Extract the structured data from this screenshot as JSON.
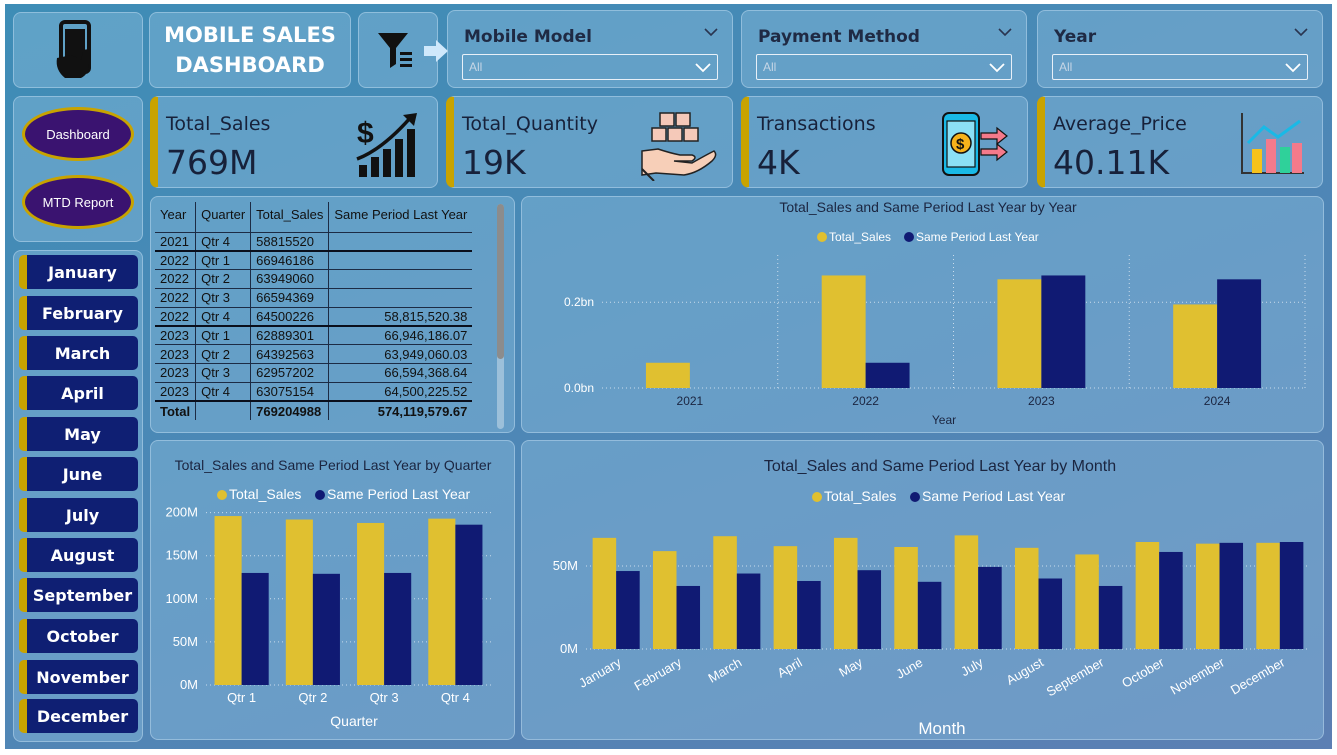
{
  "header": {
    "title": "MOBILE SALES\nDASHBOARD",
    "slicers": [
      {
        "label": "Mobile Model",
        "value": "All"
      },
      {
        "label": "Payment Method",
        "value": "All"
      },
      {
        "label": "Year",
        "value": "All"
      }
    ]
  },
  "nav": {
    "dashboard": "Dashboard",
    "mtd": "MTD Report"
  },
  "months": [
    "January",
    "February",
    "March",
    "April",
    "May",
    "June",
    "July",
    "August",
    "September",
    "October",
    "November",
    "December"
  ],
  "kpis": [
    {
      "label": "Total_Sales",
      "value": "769M",
      "icon": "dollar-growth-icon"
    },
    {
      "label": "Total_Quantity",
      "value": "19K",
      "icon": "boxes-hand-icon"
    },
    {
      "label": "Transactions",
      "value": "4K",
      "icon": "phone-payment-icon"
    },
    {
      "label": "Average_Price",
      "value": "40.11K",
      "icon": "bar-chart-icon"
    }
  ],
  "table": {
    "headers": [
      "Year",
      "Quarter",
      "Total_Sales",
      "Same Period Last Year"
    ],
    "rows": [
      [
        "2021",
        "Qtr 4",
        "58815520",
        ""
      ],
      [
        "2022",
        "Qtr 1",
        "66946186",
        ""
      ],
      [
        "2022",
        "Qtr 2",
        "63949060",
        ""
      ],
      [
        "2022",
        "Qtr 3",
        "66594369",
        ""
      ],
      [
        "2022",
        "Qtr 4",
        "64500226",
        "58,815,520.38"
      ],
      [
        "2023",
        "Qtr 1",
        "62889301",
        "66,946,186.07"
      ],
      [
        "2023",
        "Qtr 2",
        "64392563",
        "63,949,060.03"
      ],
      [
        "2023",
        "Qtr 3",
        "62957202",
        "66,594,368.64"
      ],
      [
        "2023",
        "Qtr 4",
        "63075154",
        "64,500,225.52"
      ]
    ],
    "total": [
      "Total",
      "",
      "769204988",
      "574,119,579.67"
    ]
  },
  "colors": {
    "total_sales": "#e0c030",
    "same_period": "#101a73",
    "accent": "#c8a300"
  },
  "chart_data": [
    {
      "type": "bar",
      "title": "Total_Sales and Same Period Last Year by Year",
      "xlabel": "Year",
      "ylabel": "",
      "categories": [
        "2021",
        "2022",
        "2023",
        "2024"
      ],
      "series": [
        {
          "name": "Total_Sales",
          "values": [
            58815520,
            262320000,
            253310000,
            194760000
          ]
        },
        {
          "name": "Same Period Last Year",
          "values": [
            0,
            58815520,
            262320000,
            253310000
          ]
        }
      ],
      "yticks": [
        {
          "v": 0,
          "label": "0.0bn"
        },
        {
          "v": 200000000,
          "label": "0.2bn"
        }
      ],
      "ylim": [
        0,
        310000000
      ]
    },
    {
      "type": "bar",
      "title": "Total_Sales and Same Period Last Year by Quarter",
      "xlabel": "Quarter",
      "ylabel": "",
      "categories": [
        "Qtr 1",
        "Qtr 2",
        "Qtr 3",
        "Qtr 4"
      ],
      "series": [
        {
          "name": "Total_Sales",
          "values": [
            196000000,
            192000000,
            188000000,
            193000000
          ]
        },
        {
          "name": "Same Period Last Year",
          "values": [
            130000000,
            129000000,
            130000000,
            186000000
          ]
        }
      ],
      "yticks": [
        {
          "v": 0,
          "label": "0M"
        },
        {
          "v": 50000000,
          "label": "50M"
        },
        {
          "v": 100000000,
          "label": "100M"
        },
        {
          "v": 150000000,
          "label": "150M"
        },
        {
          "v": 200000000,
          "label": "200M"
        }
      ],
      "ylim": [
        0,
        210000000
      ]
    },
    {
      "type": "bar",
      "title": "Total_Sales and Same Period Last Year by Month",
      "xlabel": "Month",
      "ylabel": "",
      "categories": [
        "January",
        "February",
        "March",
        "April",
        "May",
        "June",
        "July",
        "August",
        "September",
        "October",
        "November",
        "December"
      ],
      "series": [
        {
          "name": "Total_Sales",
          "values": [
            67000000,
            59000000,
            68000000,
            62000000,
            67000000,
            61500000,
            68500000,
            61000000,
            57000000,
            64500000,
            63500000,
            64000000
          ]
        },
        {
          "name": "Same Period Last Year",
          "values": [
            47000000,
            38000000,
            45500000,
            41000000,
            47500000,
            40500000,
            49500000,
            42500000,
            38000000,
            58500000,
            64000000,
            64500000
          ]
        }
      ],
      "yticks": [
        {
          "v": 0,
          "label": "0M"
        },
        {
          "v": 50000000,
          "label": "50M"
        }
      ],
      "ylim": [
        0,
        85000000
      ]
    }
  ]
}
